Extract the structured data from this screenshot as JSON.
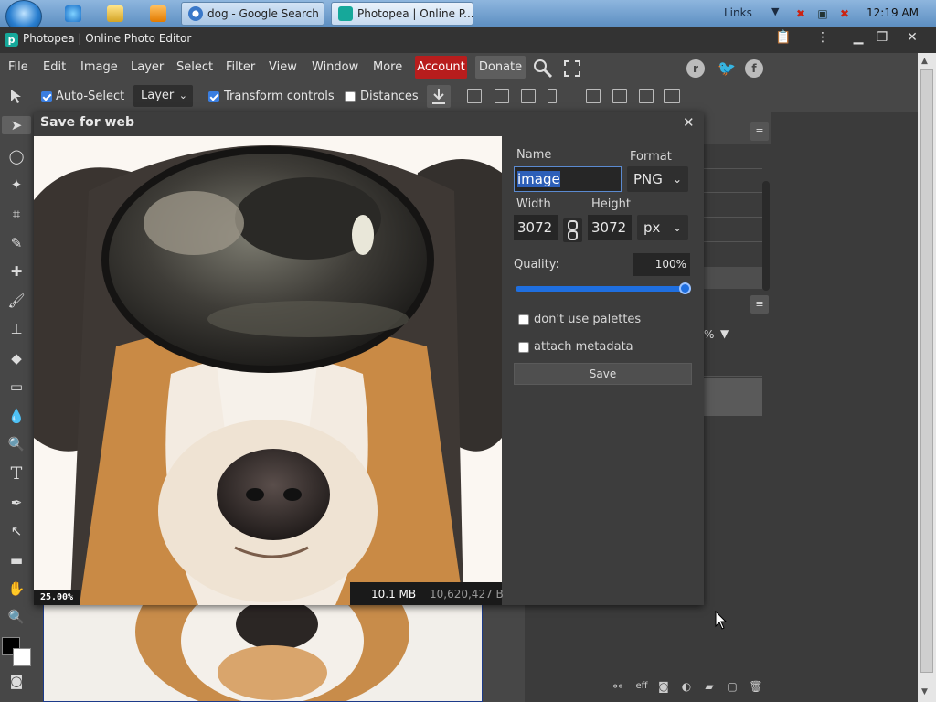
{
  "taskbar": {
    "tabs": [
      {
        "label": "dog - Google Search ..."
      },
      {
        "label": "Photopea | Online P..."
      }
    ],
    "links_label": "Links",
    "clock": "12:19 AM"
  },
  "window": {
    "title": "Photopea | Online Photo Editor"
  },
  "menu": {
    "items": [
      "File",
      "Edit",
      "Image",
      "Layer",
      "Select",
      "Filter",
      "View",
      "Window",
      "More"
    ],
    "account": "Account",
    "donate": "Donate"
  },
  "options": {
    "auto_select": "Auto-Select",
    "layer_select": "Layer",
    "transform_controls": "Transform controls",
    "distances": "Distances"
  },
  "dialog": {
    "title": "Save for web",
    "name_label": "Name",
    "name_value": "image",
    "format_label": "Format",
    "format_value": "PNG",
    "width_label": "Width",
    "width_value": "3072",
    "height_label": "Height",
    "height_value": "3072",
    "unit_value": "px",
    "quality_label": "Quality:",
    "quality_value": "100%",
    "quality_fraction": 1.0,
    "dont_use_palettes": "don't use palettes",
    "attach_metadata": "attach metadata",
    "save_label": "Save",
    "zoom": "25.00%",
    "size_mb": "10.1 MB",
    "size_bytes": "10,620,427 B"
  },
  "panel": {
    "percent": "%"
  },
  "colors": {
    "account_bg": "#b81d1d",
    "accent_blue": "#1f6fe0",
    "bg": "#474747"
  }
}
